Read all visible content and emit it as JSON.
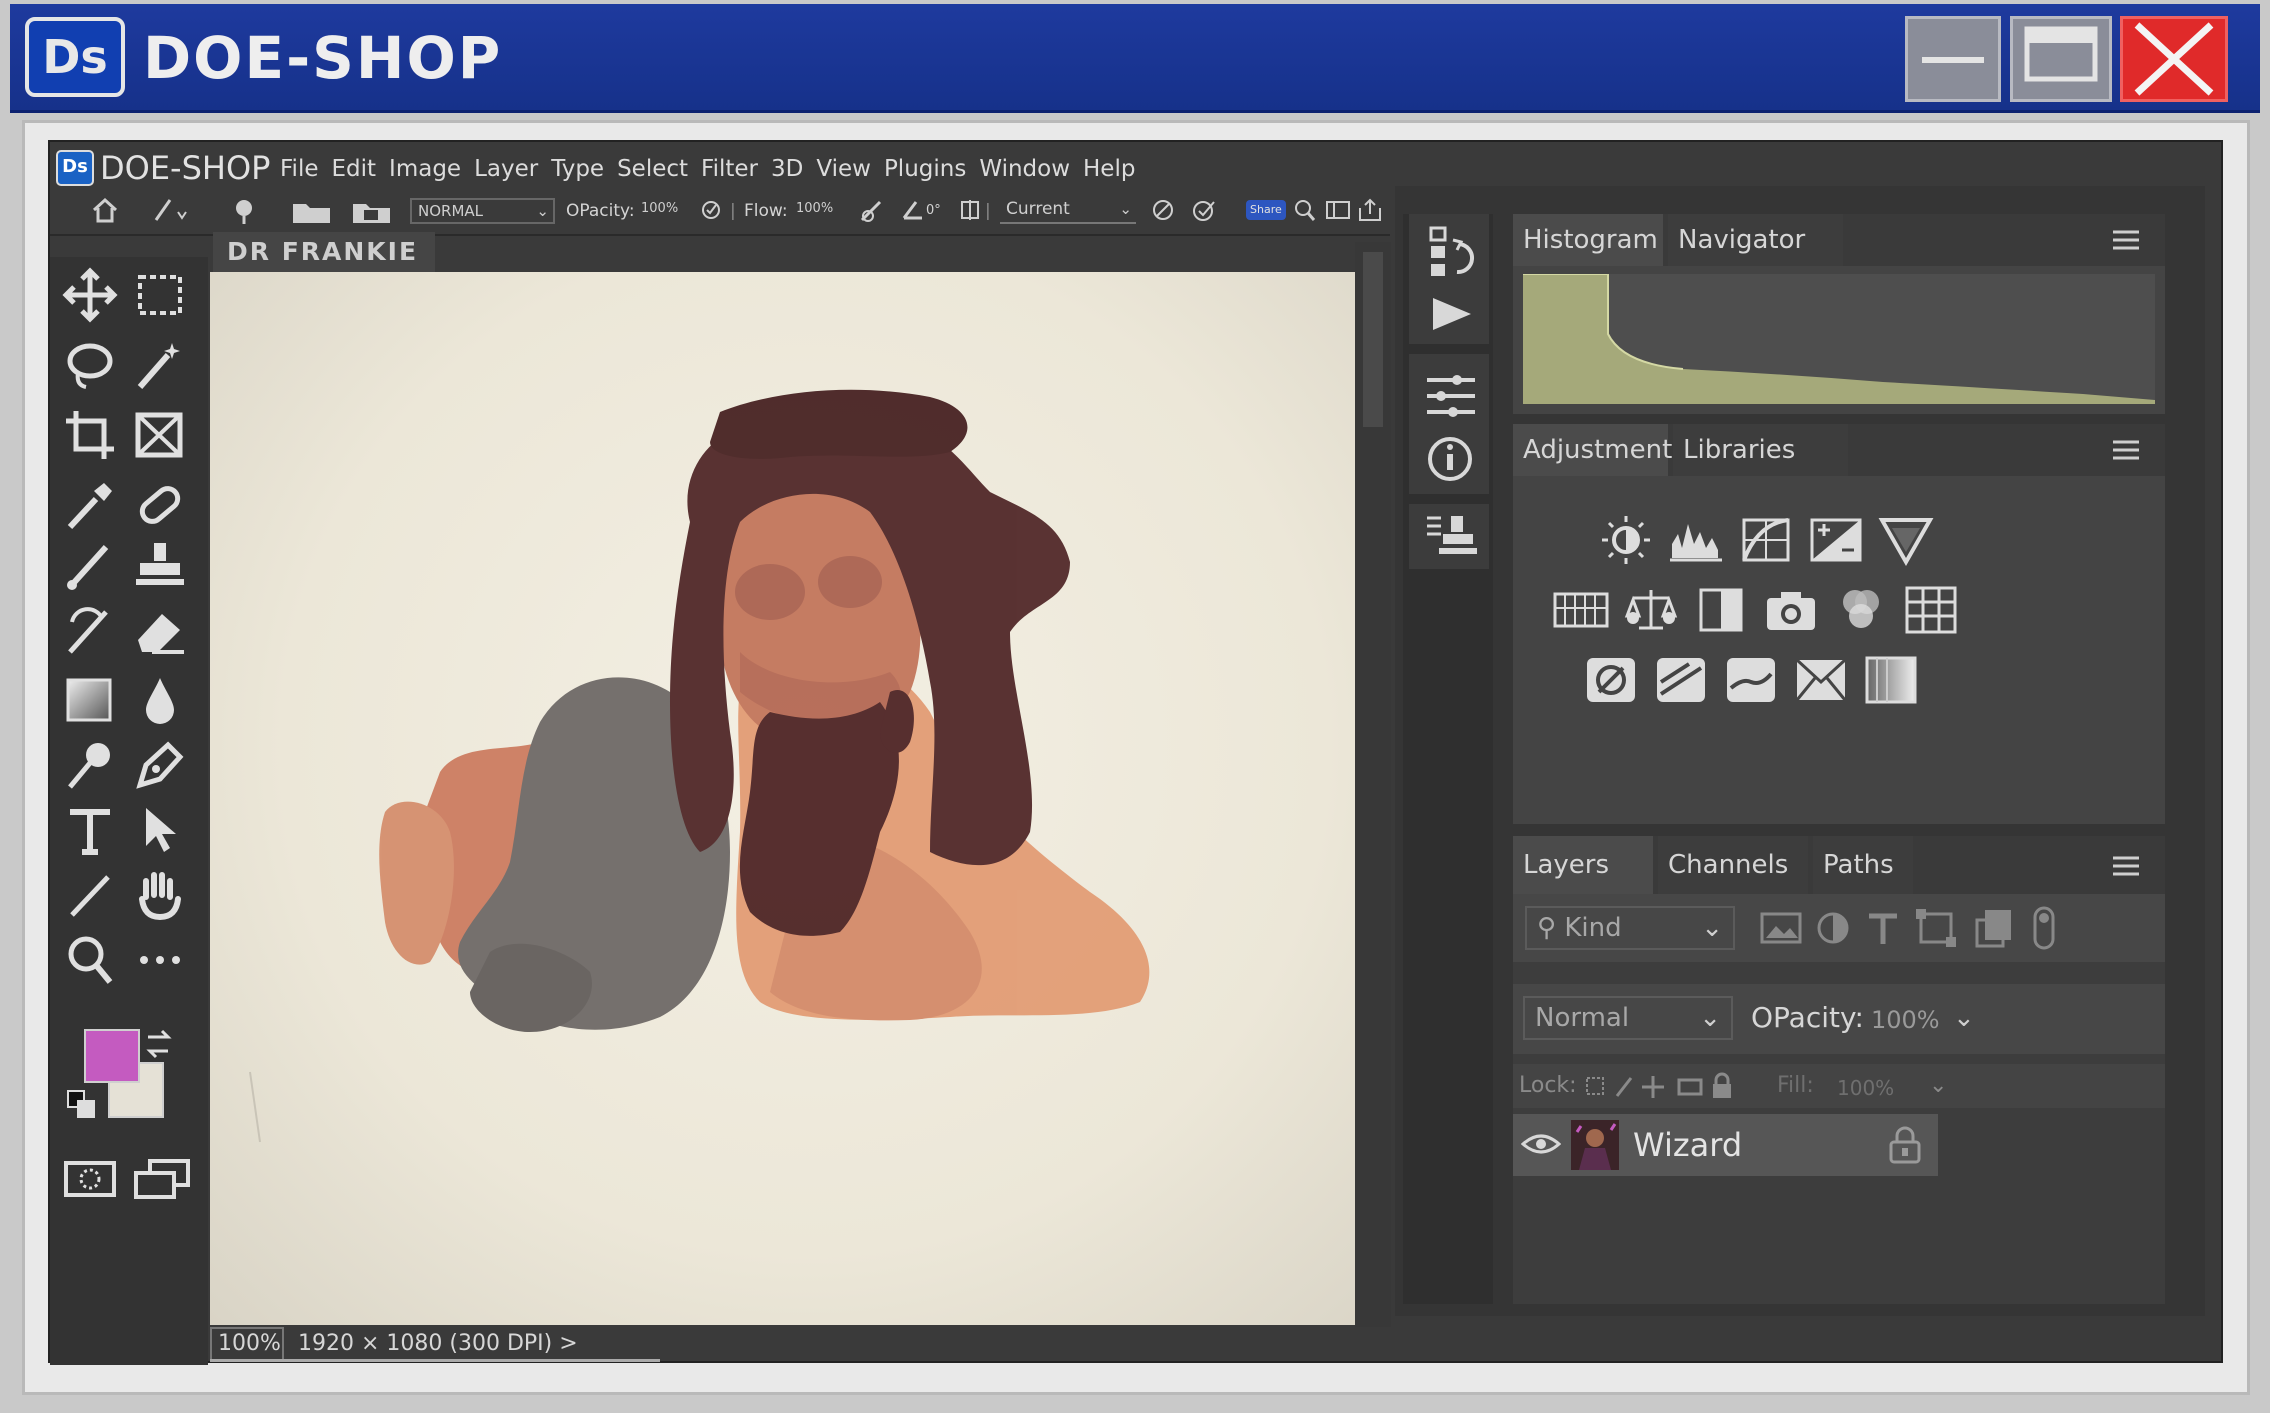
{
  "window": {
    "title": "DOE-SHOP",
    "logo_text": "Ds"
  },
  "app": {
    "logo_text": "Ds",
    "name": "DOE-SHOP",
    "menu": [
      "File",
      "Edit",
      "Image",
      "Layer",
      "Type",
      "Select",
      "Filter",
      "3D",
      "View",
      "Plugins",
      "Window",
      "Help"
    ]
  },
  "options": {
    "blend_mode": "NORMAL",
    "opacity_label": "OPacity:",
    "opacity_value": "100%",
    "flow_label": "Flow:",
    "flow_value": "100%",
    "angle_value": "0°",
    "sample_select": "Current",
    "share_label": "Share"
  },
  "document": {
    "tab_name": "DR FRANKIE",
    "zoom": "100%",
    "info": "1920 × 1080 (300 DPI) >"
  },
  "colors": {
    "foreground": "#c45bc0",
    "background": "#e5e1d6",
    "titlebar": "#1e3a9e",
    "close": "#e02a2a"
  },
  "tools": [
    "move-icon",
    "marquee-icon",
    "lasso-icon",
    "magic-wand-icon",
    "crop-icon",
    "frame-icon",
    "eyedropper-icon",
    "healing-icon",
    "brush-icon",
    "stamp-icon",
    "history-brush-icon",
    "eraser-icon",
    "gradient-icon",
    "blur-icon",
    "dodge-icon",
    "pen-icon",
    "type-icon",
    "path-select-icon",
    "line-icon",
    "hand-icon",
    "zoom-icon",
    "more-icon"
  ],
  "panels": {
    "top": {
      "tabs": [
        "Histogram",
        "Navigator"
      ]
    },
    "middle": {
      "tabs": [
        "Adjustments",
        "Libraries"
      ]
    },
    "bottom": {
      "tabs": [
        "Layers",
        "Channels",
        "Paths"
      ],
      "filter_placeholder": "Kind",
      "blend_mode": "Normal",
      "opacity_label": "OPacity:",
      "opacity_value": "100%",
      "lock_label": "Lock:",
      "fill_label": "Fill:",
      "fill_value": "100%",
      "layer_name": "Wizard"
    }
  }
}
